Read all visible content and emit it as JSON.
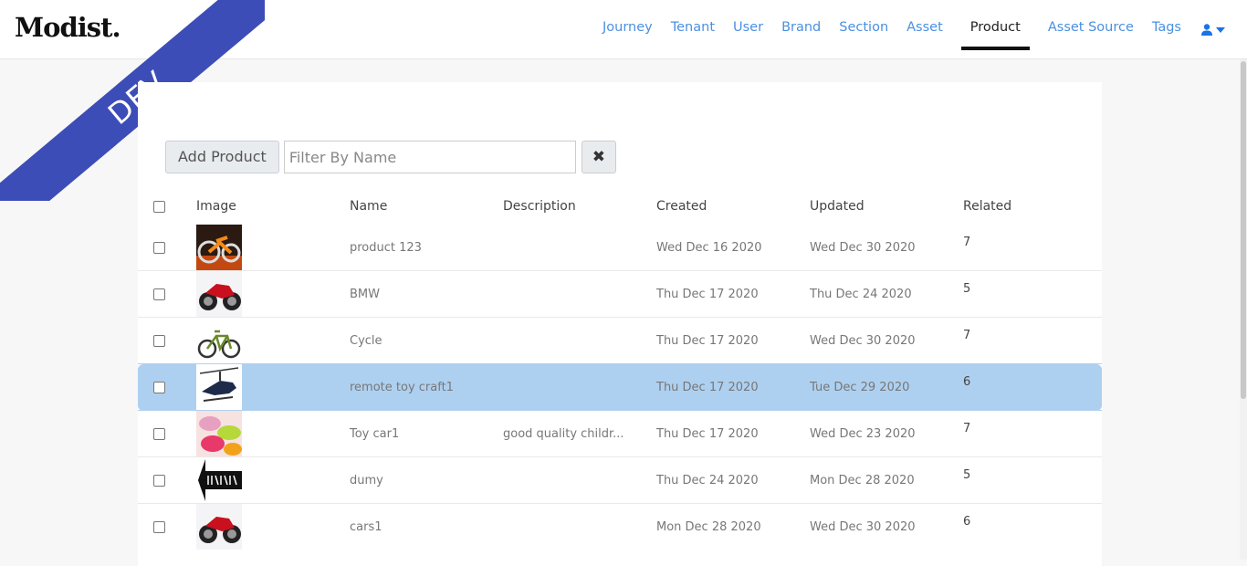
{
  "app": {
    "logo": "Modist.",
    "env_badge": "DEV"
  },
  "nav": {
    "items": [
      {
        "label": "Journey",
        "active": false
      },
      {
        "label": "Tenant",
        "active": false
      },
      {
        "label": "User",
        "active": false
      },
      {
        "label": "Brand",
        "active": false
      },
      {
        "label": "Section",
        "active": false
      },
      {
        "label": "Asset",
        "active": false
      },
      {
        "label": "Product",
        "active": true
      },
      {
        "label": "Asset Source",
        "active": false
      },
      {
        "label": "Tags",
        "active": false
      }
    ],
    "user_icon": "user-icon",
    "user_caret_icon": "caret-down-icon"
  },
  "toolbar": {
    "add_label": "Add Product",
    "filter_placeholder": "Filter By Name",
    "filter_value": "",
    "clear_icon": "close-icon"
  },
  "table": {
    "headers": {
      "image": "Image",
      "name": "Name",
      "description": "Description",
      "created": "Created",
      "updated": "Updated",
      "related": "Related"
    },
    "rows": [
      {
        "image": "motorcycle-orange-thumbnail",
        "name": "product 123",
        "description": "",
        "created": "Wed Dec 16 2020",
        "updated": "Wed Dec 30 2020",
        "related": "7",
        "selected": false
      },
      {
        "image": "motorcycle-red-thumbnail",
        "name": "BMW",
        "description": "",
        "created": "Thu Dec 17 2020",
        "updated": "Thu Dec 24 2020",
        "related": "5",
        "selected": false
      },
      {
        "image": "bicycle-thumbnail",
        "name": "Cycle",
        "description": "",
        "created": "Thu Dec 17 2020",
        "updated": "Wed Dec 30 2020",
        "related": "7",
        "selected": false
      },
      {
        "image": "helicopter-thumbnail",
        "name": "remote toy craft1",
        "description": "",
        "created": "Thu Dec 17 2020",
        "updated": "Tue Dec 29 2020",
        "related": "6",
        "selected": true
      },
      {
        "image": "toy-cars-thumbnail",
        "name": "Toy car1",
        "description": "good quality childr...",
        "created": "Thu Dec 17 2020",
        "updated": "Wed Dec 23 2020",
        "related": "7",
        "selected": false
      },
      {
        "image": "placeholder-thumbnail",
        "name": "dumy",
        "description": "",
        "created": "Thu Dec 24 2020",
        "updated": "Mon Dec 28 2020",
        "related": "5",
        "selected": false
      },
      {
        "image": "motorcycle-red-thumbnail",
        "name": "cars1",
        "description": "",
        "created": "Mon Dec 28 2020",
        "updated": "Wed Dec 30 2020",
        "related": "6",
        "selected": false
      }
    ]
  },
  "colors": {
    "nav_link": "#4a90e2",
    "ribbon": "#3d4db7",
    "selected_row": "#aed0f0"
  }
}
